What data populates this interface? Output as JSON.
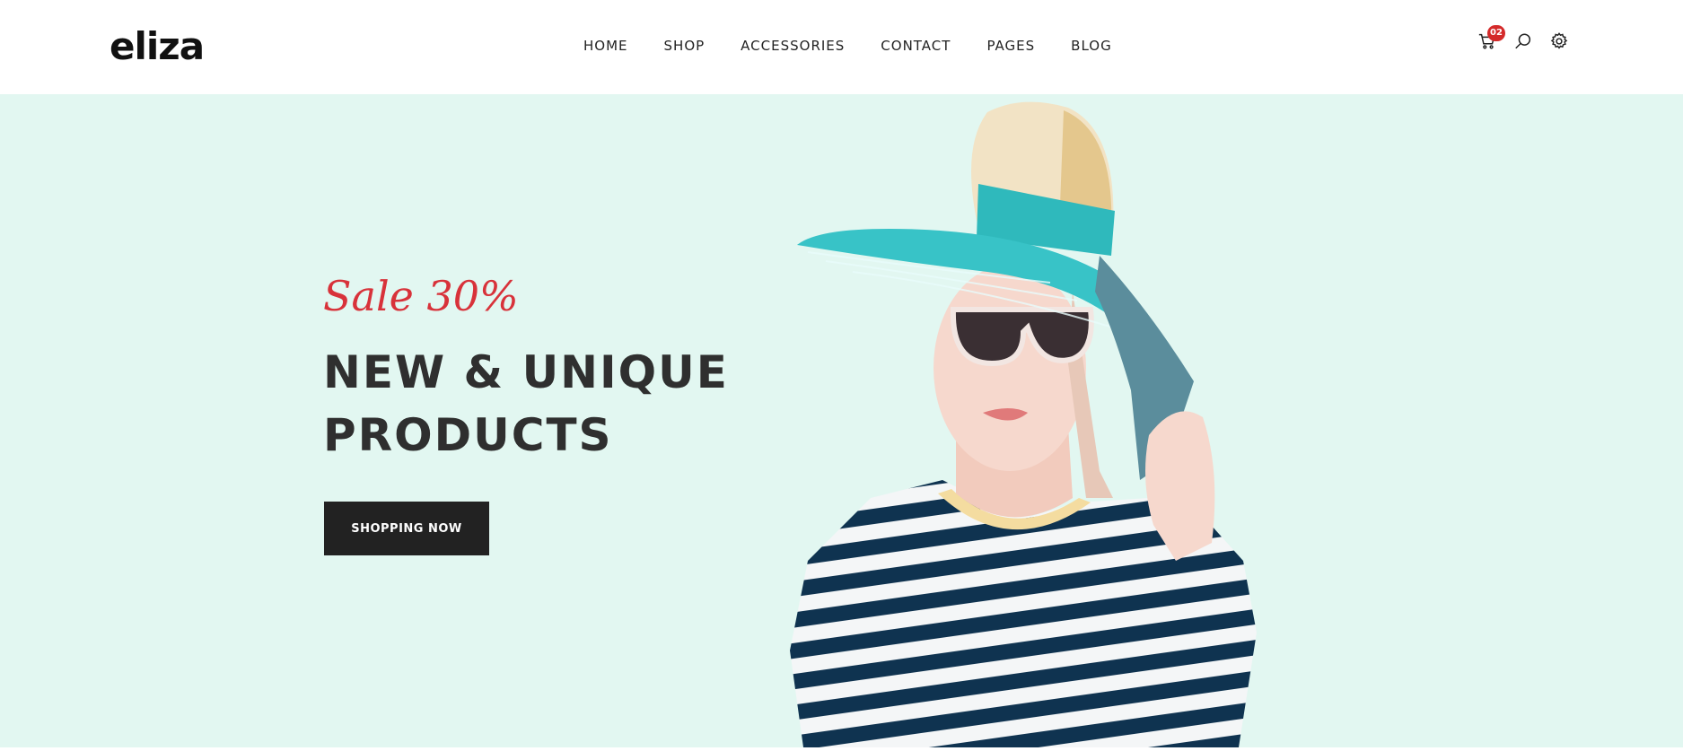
{
  "header": {
    "logo": "eliza",
    "nav": [
      "HOME",
      "SHOP",
      "ACCESSORIES",
      "CONTACT",
      "PAGES",
      "BLOG"
    ],
    "cart_count": "02",
    "icons": [
      "cart-icon",
      "search-icon",
      "gear-icon"
    ]
  },
  "hero": {
    "sale_text": "Sale 30%",
    "headline": "NEW & UNIQUE PRODUCTS",
    "cta_label": "SHOPPING NOW",
    "background_color": "#e2f7f1",
    "sale_color": "#d8323a"
  }
}
